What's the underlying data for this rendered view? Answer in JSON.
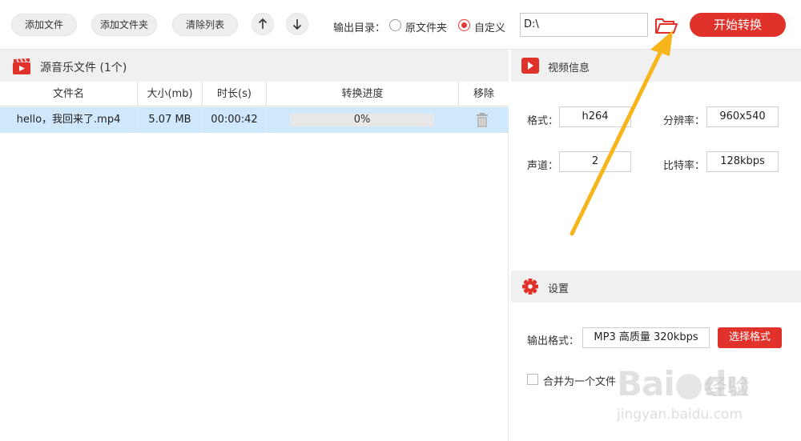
{
  "toolbar": {
    "add_file": "添加文件",
    "add_folder": "添加文件夹",
    "clear_list": "清除列表",
    "up_icon": "arrow-up-icon",
    "down_icon": "arrow-down-icon",
    "output_dir_label": "输出目录：",
    "radio_original": "原文件夹",
    "radio_custom": "自定义",
    "selected_radio": "自定义",
    "output_path": "D:\\",
    "folder_icon": "folder-open-icon",
    "start_button": "开始转换",
    "accent": "#e0312b"
  },
  "left": {
    "title": "源音乐文件 (1个)",
    "columns": [
      "文件名",
      "大小(mb)",
      "时长(s)",
      "转换进度",
      "移除"
    ],
    "rows": [
      {
        "name": "hello，我回来了.mp4",
        "size": "5.07 MB",
        "duration": "00:00:42",
        "progress": "0%",
        "progress_value": 0
      }
    ],
    "row_highlight": "#cfe8fb"
  },
  "video_info": {
    "title": "视频信息",
    "format_label": "格式：",
    "format_value": "h264",
    "resolution_label": "分辨率：",
    "resolution_value": "960x540",
    "channel_label": "声道：",
    "channel_value": "2",
    "bitrate_label": "比特率：",
    "bitrate_value": "128kbps"
  },
  "settings": {
    "title": "设置",
    "output_format_label": "输出格式：",
    "output_format_value": "MP3 高质量 320kbps",
    "choose_format_button": "选择格式",
    "merge_label": "合并为一个文件",
    "merge_checked": false
  },
  "watermark": {
    "brand": "Bai",
    "brand2": "du",
    "suffix": "经验",
    "url": "jingyan.baidu.com"
  }
}
